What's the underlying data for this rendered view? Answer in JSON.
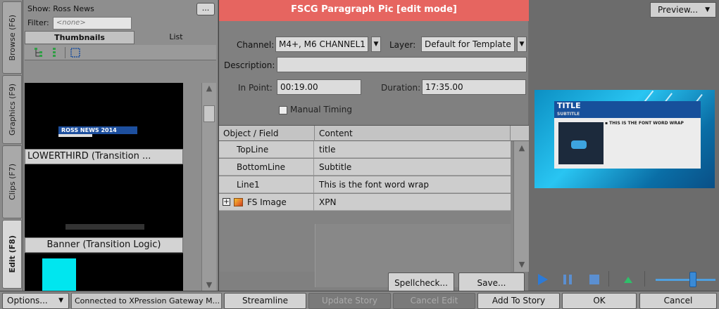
{
  "side_tabs": [
    "Browse (F6)",
    "Graphics (F9)",
    "Clips (F7)",
    "Edit (F8)"
  ],
  "browse": {
    "show_label": "Show: Ross News",
    "ellipsis_label": "...",
    "filter_label": "Filter:",
    "filter_placeholder": "<none>",
    "view_tabs": [
      "Thumbnails",
      "List"
    ],
    "thumbnails": [
      {
        "caption": "LOWERTHIRD (Transition ...",
        "overlay_text": "ROSS NEWS 2014"
      },
      {
        "caption": "Banner (Transition Logic)"
      }
    ]
  },
  "editor": {
    "title": "FSCG Paragraph Pic [edit mode]",
    "title_color": "#e66560",
    "channel_label": "Channel:",
    "channel_value": "M4+, M6 CHANNEL1",
    "layer_label": "Layer:",
    "layer_value": "Default for Template",
    "description_label": "Description:",
    "description_value": "",
    "in_point_label": "In Point:",
    "in_point_value": "00:19.00",
    "duration_label": "Duration:",
    "duration_value": "17:35.00",
    "manual_timing_label": "Manual Timing",
    "manual_timing_checked": false,
    "columns": [
      "Object / Field",
      "Content"
    ],
    "rows": [
      {
        "field": "TopLine",
        "content": "title"
      },
      {
        "field": "BottomLine",
        "content": "Subtitle"
      },
      {
        "field": "Line1",
        "content": "This is the font word wrap"
      },
      {
        "field": "FS Image",
        "content": "XPN"
      }
    ],
    "spellcheck_label": "Spellcheck...",
    "save_label": "Save..."
  },
  "preview": {
    "button_label": "Preview...",
    "title_text": "TITLE",
    "subtitle_text": "SUBTITLE",
    "body_text": "THIS IS THE FONT WORD WRAP"
  },
  "bottom": {
    "options_label": "Options...",
    "status": "Connected to XPression Gateway M...",
    "streamline_label": "Streamline",
    "update_story_label": "Update Story",
    "cancel_edit_label": "Cancel Edit",
    "add_to_story_label": "Add To Story",
    "ok_label": "OK",
    "cancel_label": "Cancel"
  }
}
